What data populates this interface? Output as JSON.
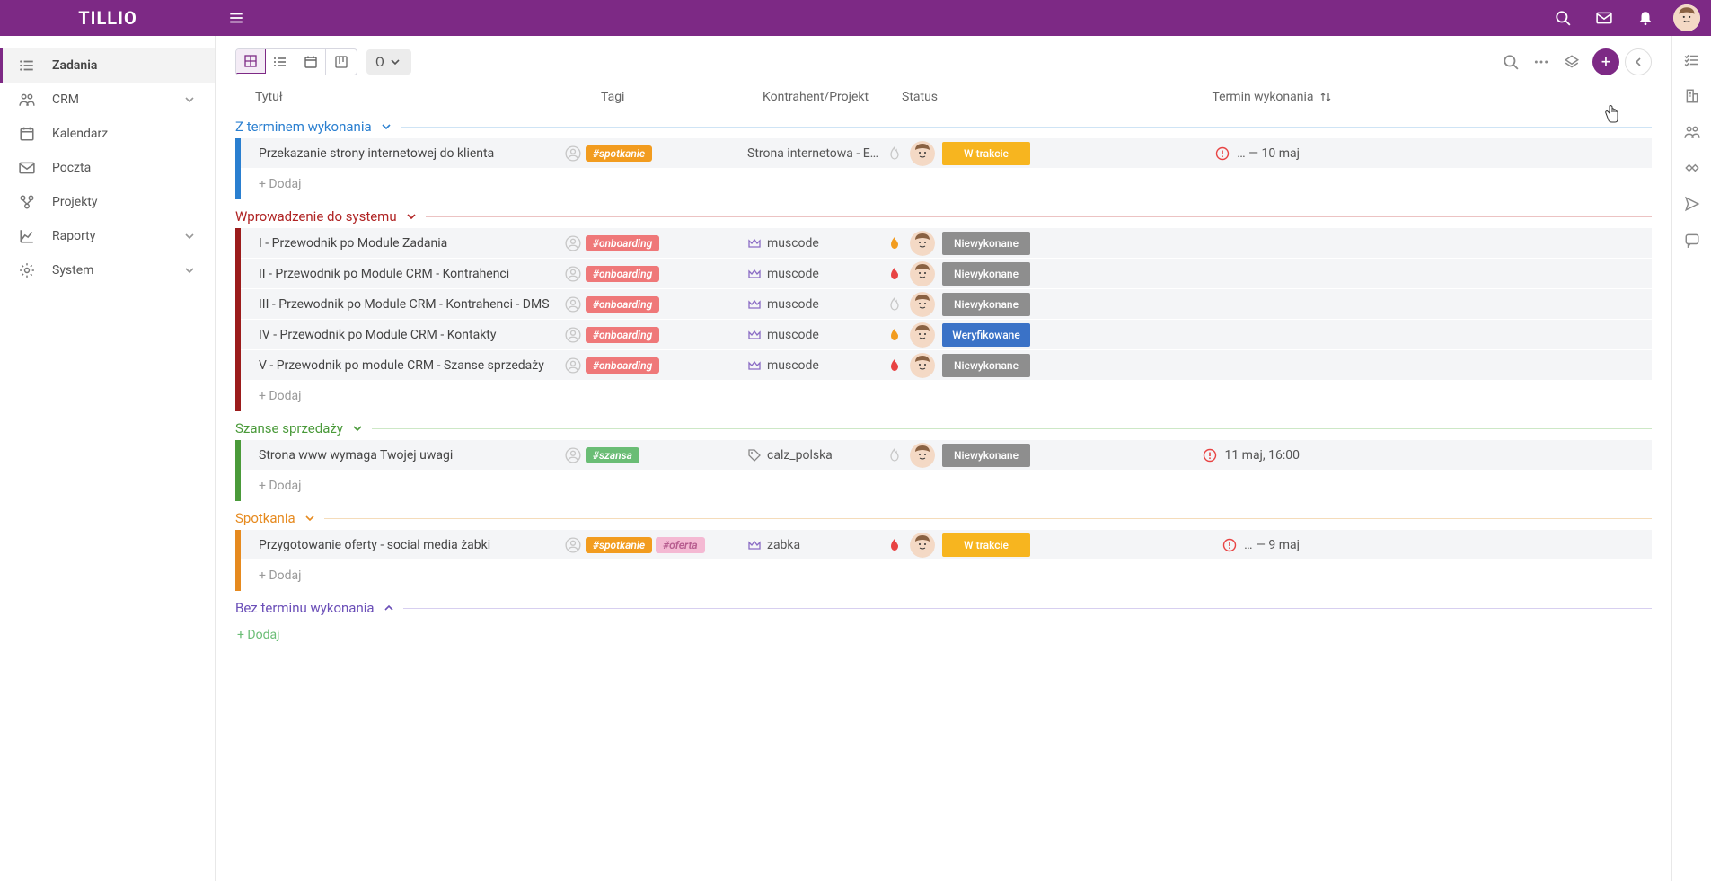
{
  "app_name": "TILLIO",
  "sidebar": {
    "items": [
      {
        "label": "Zadania",
        "icon": "list",
        "active": true,
        "expandable": false
      },
      {
        "label": "CRM",
        "icon": "users",
        "active": false,
        "expandable": true
      },
      {
        "label": "Kalendarz",
        "icon": "calendar",
        "active": false,
        "expandable": false
      },
      {
        "label": "Poczta",
        "icon": "mail",
        "active": false,
        "expandable": false
      },
      {
        "label": "Projekty",
        "icon": "org",
        "active": false,
        "expandable": false
      },
      {
        "label": "Raporty",
        "icon": "chart",
        "active": false,
        "expandable": true
      },
      {
        "label": "System",
        "icon": "gear",
        "active": false,
        "expandable": true
      }
    ]
  },
  "toolbar": {
    "omega_label": "Ω"
  },
  "columns": {
    "title": "Tytuł",
    "tags": "Tagi",
    "contractor": "Kontrahent/Projekt",
    "status": "Status",
    "deadline": "Termin wykonania"
  },
  "sections": [
    {
      "id": "s1",
      "title": "Z terminem wykonania",
      "color": "blue",
      "expanded": true,
      "rows": [
        {
          "title": "Przekazanie strony internetowej do klienta",
          "tags": [
            {
              "text": "#spotkanie",
              "cls": "spotkanie"
            }
          ],
          "contractor_icon": "none",
          "contractor": "Strona internetowa - E…",
          "flame": "grey",
          "status": {
            "text": "W trakcie",
            "cls": "wtrakcie"
          },
          "deadline": "… — 10 maj",
          "deadline_warn": true
        }
      ],
      "add_label": "+ Dodaj"
    },
    {
      "id": "s2",
      "title": "Wprowadzenie do systemu",
      "color": "red",
      "expanded": true,
      "rows": [
        {
          "title": "I - Przewodnik po Module Zadania",
          "tags": [
            {
              "text": "#onboarding",
              "cls": "onboarding"
            }
          ],
          "contractor_icon": "crown",
          "contractor": "muscode",
          "flame": "orange",
          "status": {
            "text": "Niewykonane",
            "cls": "niewykonane"
          },
          "deadline": "",
          "deadline_warn": false
        },
        {
          "title": "II - Przewodnik po Module CRM - Kontrahenci",
          "tags": [
            {
              "text": "#onboarding",
              "cls": "onboarding"
            }
          ],
          "contractor_icon": "crown",
          "contractor": "muscode",
          "flame": "red",
          "status": {
            "text": "Niewykonane",
            "cls": "niewykonane"
          },
          "deadline": "",
          "deadline_warn": false
        },
        {
          "title": "III - Przewodnik po Module CRM - Kontrahenci - DMS",
          "tags": [
            {
              "text": "#onboarding",
              "cls": "onboarding"
            }
          ],
          "contractor_icon": "crown",
          "contractor": "muscode",
          "flame": "grey",
          "status": {
            "text": "Niewykonane",
            "cls": "niewykonane"
          },
          "deadline": "",
          "deadline_warn": false
        },
        {
          "title": "IV - Przewodnik po Module CRM - Kontakty",
          "tags": [
            {
              "text": "#onboarding",
              "cls": "onboarding"
            }
          ],
          "contractor_icon": "crown",
          "contractor": "muscode",
          "flame": "orange",
          "status": {
            "text": "Weryfikowane",
            "cls": "weryfikowane"
          },
          "deadline": "",
          "deadline_warn": false
        },
        {
          "title": "V - Przewodnik po module CRM - Szanse sprzedaży",
          "tags": [
            {
              "text": "#onboarding",
              "cls": "onboarding"
            }
          ],
          "contractor_icon": "crown",
          "contractor": "muscode",
          "flame": "red",
          "status": {
            "text": "Niewykonane",
            "cls": "niewykonane"
          },
          "deadline": "",
          "deadline_warn": false
        }
      ],
      "add_label": "+ Dodaj"
    },
    {
      "id": "s3",
      "title": "Szanse sprzedaży",
      "color": "green",
      "expanded": true,
      "rows": [
        {
          "title": "Strona www wymaga Twojej uwagi",
          "tags": [
            {
              "text": "#szansa",
              "cls": "szansa"
            }
          ],
          "contractor_icon": "tag",
          "contractor": "calz_polska",
          "flame": "grey",
          "status": {
            "text": "Niewykonane",
            "cls": "niewykonane"
          },
          "deadline": "11 maj, 16:00",
          "deadline_warn": true
        }
      ],
      "add_label": "+ Dodaj"
    },
    {
      "id": "s4",
      "title": "Spotkania",
      "color": "orange",
      "expanded": true,
      "rows": [
        {
          "title": "Przygotowanie oferty - social media żabki",
          "tags": [
            {
              "text": "#spotkanie",
              "cls": "spotkanie"
            },
            {
              "text": "#oferta",
              "cls": "oferta"
            }
          ],
          "contractor_icon": "crown",
          "contractor": "zabka",
          "flame": "red",
          "status": {
            "text": "W trakcie",
            "cls": "wtrakcie"
          },
          "deadline": "… — 9 maj",
          "deadline_warn": true
        }
      ],
      "add_label": "+ Dodaj"
    },
    {
      "id": "s5",
      "title": "Bez terminu wykonania",
      "color": "purple",
      "expanded": false,
      "rows": [],
      "add_label": "+ Dodaj"
    }
  ],
  "final_add_label": "+ Dodaj"
}
